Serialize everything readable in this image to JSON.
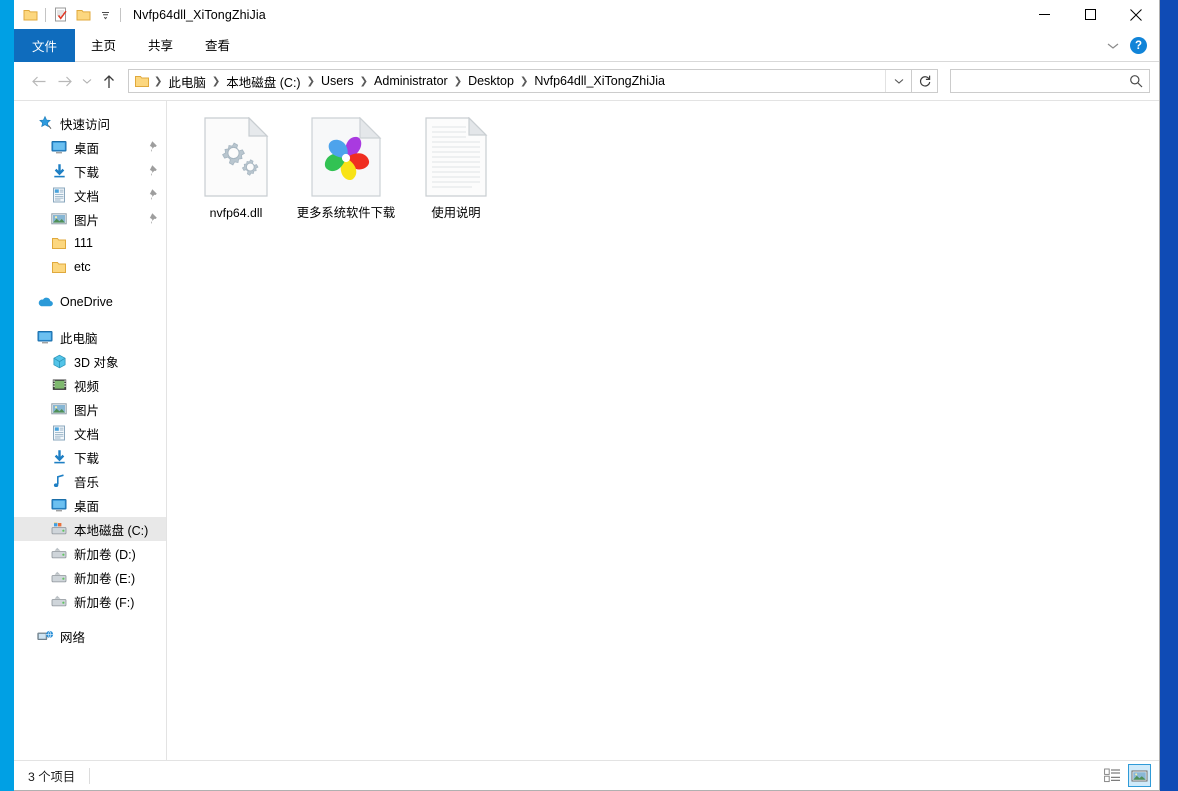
{
  "window": {
    "title": "Nvfp64dll_XiTongZhiJia",
    "accent_blue": "#0f6cbd",
    "desktop_left_color": "#00a0e4",
    "desktop_right_color": "#0f4bb5",
    "controls": {
      "minimize": "minimize-button",
      "maximize": "maximize-button",
      "close": "close-button"
    }
  },
  "quick_access_toolbar": {
    "items": [
      {
        "name": "folder-icon",
        "label": ""
      },
      {
        "name": "properties-icon",
        "label": ""
      },
      {
        "name": "new-folder-icon",
        "label": ""
      },
      {
        "name": "customize-dropdown-icon",
        "label": ""
      }
    ]
  },
  "ribbon": {
    "tabs": [
      {
        "id": "file",
        "label": "文件",
        "selected": true
      },
      {
        "id": "home",
        "label": "主页",
        "selected": false
      },
      {
        "id": "share",
        "label": "共享",
        "selected": false
      },
      {
        "id": "view",
        "label": "查看",
        "selected": false
      }
    ],
    "collapse_icon": "chevron-down-icon",
    "help_label": "?"
  },
  "address_bar": {
    "back_icon": "arrow-left-icon",
    "forward_icon": "arrow-right-icon",
    "recent_icon": "chevron-down-icon",
    "up_icon": "arrow-up-icon",
    "breadcrumb": [
      "此电脑",
      "本地磁盘 (C:)",
      "Users",
      "Administrator",
      "Desktop",
      "Nvfp64dll_XiTongZhiJia"
    ],
    "breadcrumb_dropdown_icon": "chevron-down-icon",
    "refresh_icon": "refresh-icon",
    "search": {
      "value": "",
      "placeholder": "",
      "icon": "search-icon"
    }
  },
  "nav_pane": {
    "groups": [
      {
        "header": {
          "label": "快速访问",
          "icon": "star-pin-icon"
        },
        "items": [
          {
            "label": "桌面",
            "icon": "desktop-icon",
            "pinned": true
          },
          {
            "label": "下载",
            "icon": "downloads-icon",
            "pinned": true
          },
          {
            "label": "文档",
            "icon": "documents-icon",
            "pinned": true
          },
          {
            "label": "图片",
            "icon": "pictures-icon",
            "pinned": true
          },
          {
            "label": "111",
            "icon": "folder-icon",
            "pinned": false
          },
          {
            "label": "etc",
            "icon": "folder-icon",
            "pinned": false
          }
        ]
      },
      {
        "header": {
          "label": "OneDrive",
          "icon": "onedrive-cloud-icon"
        },
        "items": []
      },
      {
        "header": {
          "label": "此电脑",
          "icon": "this-pc-icon"
        },
        "items": [
          {
            "label": "3D 对象",
            "icon": "3d-objects-icon",
            "pinned": false
          },
          {
            "label": "视频",
            "icon": "videos-icon",
            "pinned": false
          },
          {
            "label": "图片",
            "icon": "pictures-icon",
            "pinned": false
          },
          {
            "label": "文档",
            "icon": "documents-icon",
            "pinned": false
          },
          {
            "label": "下载",
            "icon": "downloads-icon",
            "pinned": false
          },
          {
            "label": "音乐",
            "icon": "music-icon",
            "pinned": false
          },
          {
            "label": "桌面",
            "icon": "desktop-icon",
            "pinned": false
          },
          {
            "label": "本地磁盘 (C:)",
            "icon": "system-drive-icon",
            "pinned": false,
            "selected": true
          },
          {
            "label": "新加卷 (D:)",
            "icon": "drive-icon",
            "pinned": false
          },
          {
            "label": "新加卷 (E:)",
            "icon": "drive-icon",
            "pinned": false
          },
          {
            "label": "新加卷 (F:)",
            "icon": "drive-icon",
            "pinned": false
          }
        ]
      },
      {
        "header": {
          "label": "网络",
          "icon": "network-icon"
        },
        "items": []
      }
    ]
  },
  "files": {
    "items": [
      {
        "name": "nvfp64.dll",
        "icon": "dll-gears-file-icon"
      },
      {
        "name": "更多系统软件下载",
        "icon": "browser-pinwheel-shortcut-icon"
      },
      {
        "name": "使用说明",
        "icon": "text-document-icon"
      }
    ]
  },
  "status_bar": {
    "item_count_text": "3 个项目",
    "views": [
      {
        "id": "details",
        "icon": "details-view-icon",
        "active": false
      },
      {
        "id": "large-icons",
        "icon": "large-icons-view-icon",
        "active": true
      }
    ]
  }
}
